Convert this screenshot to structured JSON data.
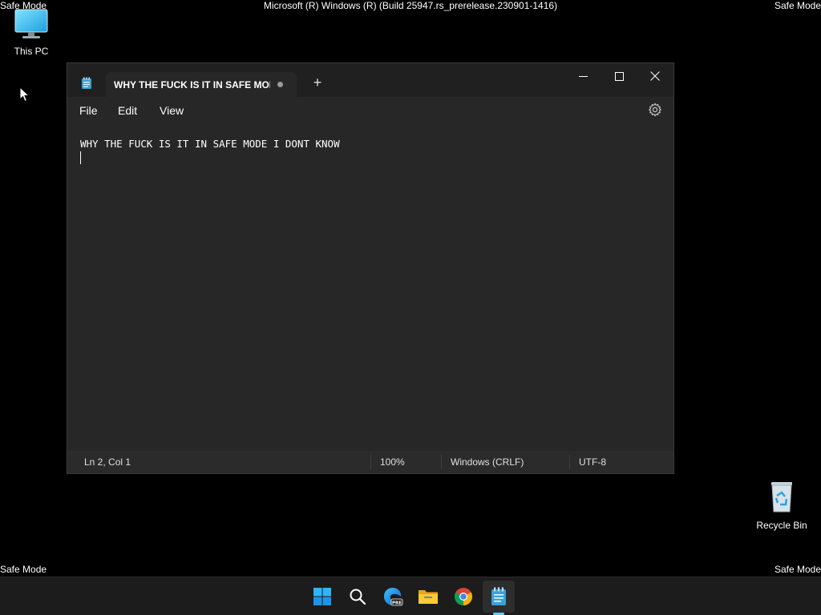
{
  "desktop": {
    "watermark_text": "Safe Mode",
    "build_text": "Microsoft (R) Windows (R) (Build 25947.rs_prerelease.230901-1416)",
    "icons": [
      {
        "label": "This PC",
        "icon": "monitor-icon"
      },
      {
        "label": "Recycle Bin",
        "icon": "recycle-bin-icon"
      }
    ]
  },
  "notepad": {
    "tab_title": "WHY THE FUCK IS IT IN SAFE MOD",
    "new_tab_label": "+",
    "menu": [
      "File",
      "Edit",
      "View"
    ],
    "content_lines": [
      "WHY THE FUCK IS IT IN SAFE MODE I DONT KNOW",
      ""
    ],
    "status": {
      "position": "Ln 2, Col 1",
      "zoom": "100%",
      "line_ending": "Windows (CRLF)",
      "encoding": "UTF-8"
    }
  },
  "taskbar": {
    "items": [
      {
        "name": "Start",
        "icon": "windows-start-icon"
      },
      {
        "name": "Search",
        "icon": "search-icon"
      },
      {
        "name": "Microsoft Edge Preview",
        "icon": "edge-preview-icon"
      },
      {
        "name": "File Explorer",
        "icon": "folder-icon"
      },
      {
        "name": "Google Chrome",
        "icon": "chrome-icon"
      },
      {
        "name": "Notepad",
        "icon": "notepad-icon",
        "active": true
      }
    ]
  },
  "colors": {
    "accent": "#60cdff",
    "window_bg": "#272727",
    "titlebar_bg": "#202020",
    "taskbar_bg": "#1c1c1c"
  }
}
